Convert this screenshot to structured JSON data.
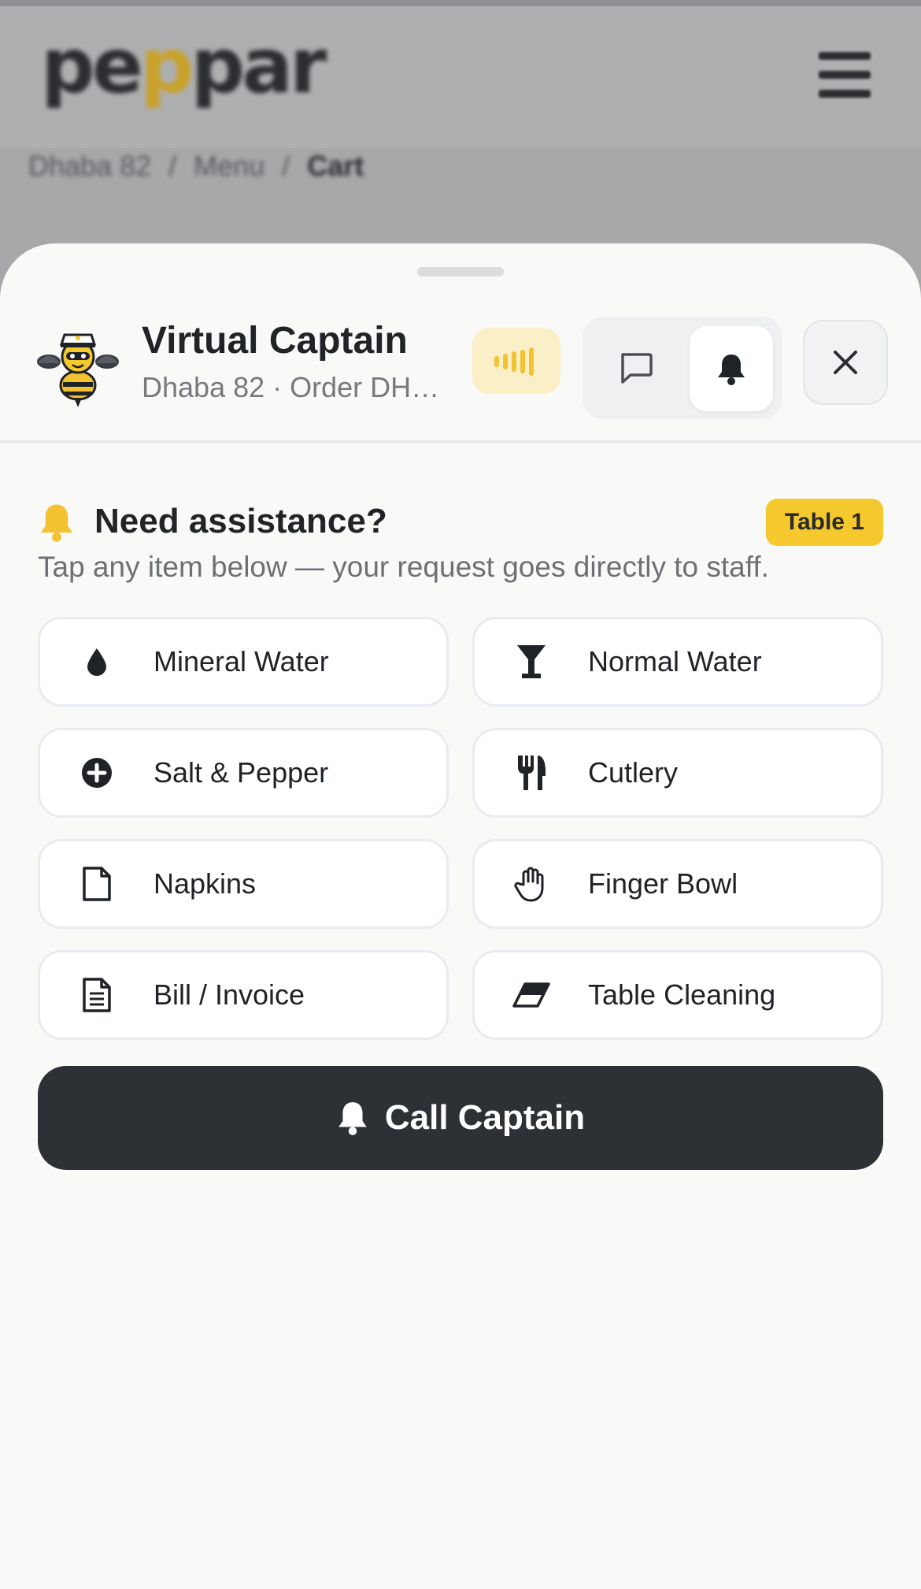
{
  "background": {
    "logo_prefix": "pe",
    "logo_accent": "p",
    "logo_suffix": "par",
    "breadcrumbs": [
      "Dhaba 82",
      "/",
      "Menu",
      "/",
      "Cart"
    ]
  },
  "header": {
    "title": "Virtual Captain",
    "subtitle": "Dhaba 82 · Order DH0..."
  },
  "assistance": {
    "title": "Need assistance?",
    "table_badge": "Table 1",
    "subtitle": "Tap any item below — your request goes directly to staff."
  },
  "items": [
    {
      "label": "Mineral Water",
      "icon": "water-drop-icon"
    },
    {
      "label": "Normal Water",
      "icon": "glass-icon"
    },
    {
      "label": "Salt & Pepper",
      "icon": "plus-circle-icon"
    },
    {
      "label": "Cutlery",
      "icon": "cutlery-icon"
    },
    {
      "label": "Napkins",
      "icon": "napkin-icon"
    },
    {
      "label": "Finger Bowl",
      "icon": "hand-icon"
    },
    {
      "label": "Bill / Invoice",
      "icon": "invoice-icon"
    },
    {
      "label": "Table Cleaning",
      "icon": "eraser-icon"
    }
  ],
  "call_button": {
    "label": "Call Captain"
  },
  "colors": {
    "accent": "#f5c92e",
    "dark": "#2d3136",
    "sheet_bg": "#f9f9f8"
  }
}
